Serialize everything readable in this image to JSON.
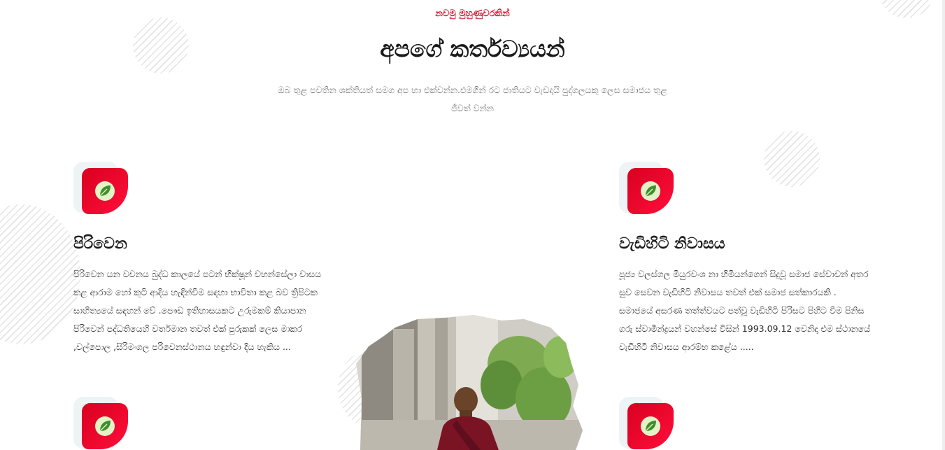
{
  "header": {
    "eyebrow": "නවමු මුහුණුවරකින්",
    "title": "අපගේ කර්තව්‍යයන්",
    "subtitle": "ඔබ තුළ පවතින ශක්තියත් සමග අප හා එක්වන්න.එමගින් රට ජාතියට වැඩදායි පුද්ගලයකු ලෙස සමාජය තුළ ජීවත් වන්න"
  },
  "cards": [
    {
      "icon": "leaf-icon",
      "title": "පිරිවෙන",
      "text": "පිරිවෙන යන වචනය බුද්ධ කාලයේ පටන් භික්ෂූන් වහන්සේලා වාසය කළ ආරාම හෝ කුටි ආදිය හැඳින්වීම සඳහා භාවිතා කළ බව ත්‍රිපිටක සාහිත්‍යයේ සඳහන් වේ .පෞඩ ඉතිහාසයකට උරුමකම් කියාපාන පිරිවෙන් පද්ධතියෙහි වර්තමාන තවත් එක් පුරුකක් ලෙස මාකර ,වල්පොල ,සිරිමංගල පරිවෙනස්ථානය හඳුන්වා දිය හැකිය ..."
    },
    {
      "icon": "leaf-icon",
      "title": "වැඩිහිටි නිවාසය",
      "text": "පූජ්‍ය වලස්ගල මියුරවංශ නා හිමියන්ගෙන් සිදුවූ සමාජ සේවාවන් අතර සුව සෙවන වැඩිහිටි නිවාසය තවත් එක් සමාජ සත්කාරයකි . සමාජයේ අසරණ තත්ත්වයට පත්වූ වැඩිහිටි පිරිසට පිහිට වීම පිනිස ගරු ස්වාමීන්ද්‍රයන් වහන්සේ විසින් 1993.09.12 වෙනිදා එම ස්ථානයේ වැඩිහිටි නිවාසය ආරම්භ කළේය ....."
    },
    {
      "icon": "leaf-icon"
    },
    {
      "icon": "leaf-icon"
    }
  ],
  "photo": {
    "icon": "monk-photo"
  },
  "colors": {
    "accent": "#d4102a",
    "icon_gradient_start": "#d8001f",
    "icon_gradient_end": "#ff0f3b",
    "leaf": "#3f8f2c",
    "leaf_circle": "#e3f3c7"
  }
}
